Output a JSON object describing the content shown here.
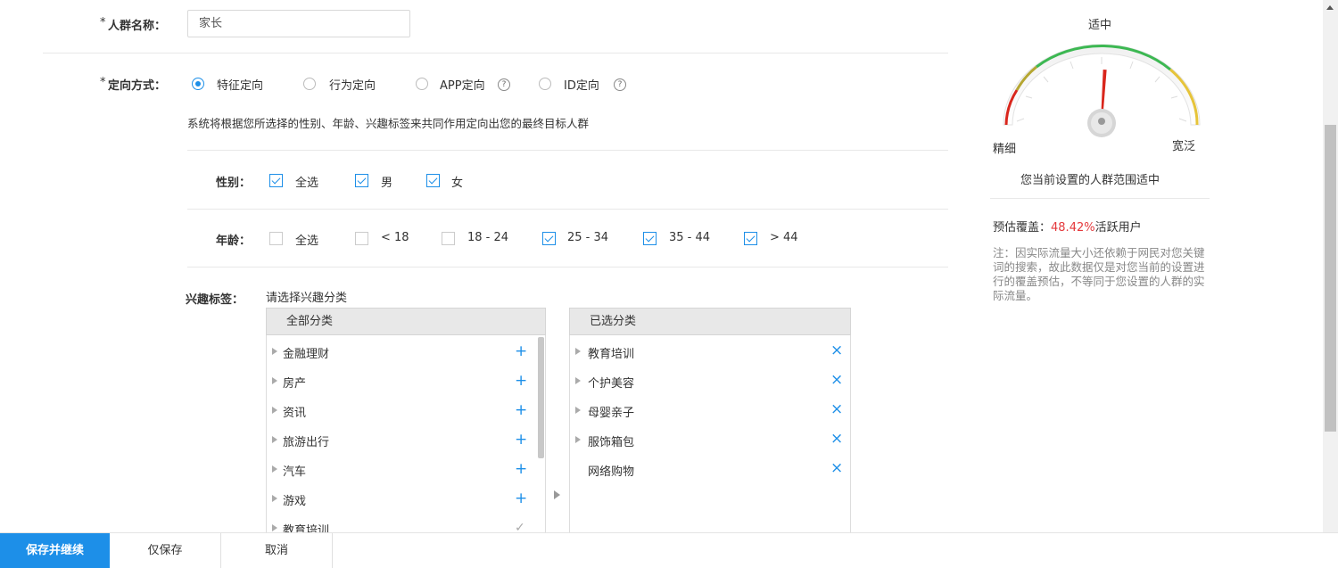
{
  "form": {
    "name_label": "人群名称：",
    "name_required": "*",
    "name_value": "家长",
    "target_label": "定向方式：",
    "target_required": "*",
    "target_options": [
      {
        "label": "特征定向",
        "selected": true
      },
      {
        "label": "行为定向",
        "selected": false
      },
      {
        "label": "APP定向",
        "selected": false
      },
      {
        "label": "ID定向",
        "selected": false
      }
    ],
    "help_glyph": "?",
    "description": "系统将根据您所选择的性别、年龄、兴趣标签来共同作用定向出您的最终目标人群",
    "gender_label": "性别：",
    "gender_options": [
      {
        "label": "全选",
        "checked": true
      },
      {
        "label": "男",
        "checked": true
      },
      {
        "label": "女",
        "checked": true
      }
    ],
    "age_label": "年龄：",
    "age_options": [
      {
        "label": "全选",
        "checked": false
      },
      {
        "label": "< 18",
        "checked": false
      },
      {
        "label": "18 - 24",
        "checked": false
      },
      {
        "label": "25 - 34",
        "checked": true
      },
      {
        "label": "35 - 44",
        "checked": true
      },
      {
        "label": "> 44",
        "checked": true
      }
    ],
    "interest_label": "兴趣标签：",
    "interest_hint": "请选择兴趣分类",
    "all_panel_title": "全部分类",
    "all_categories": [
      {
        "label": "金融理财",
        "action": "+",
        "added": false
      },
      {
        "label": "房产",
        "action": "+",
        "added": false
      },
      {
        "label": "资讯",
        "action": "+",
        "added": false
      },
      {
        "label": "旅游出行",
        "action": "+",
        "added": false
      },
      {
        "label": "汽车",
        "action": "+",
        "added": false
      },
      {
        "label": "游戏",
        "action": "+",
        "added": false
      },
      {
        "label": "教育培训",
        "action": "✓",
        "added": true
      }
    ],
    "selected_panel_title": "已选分类",
    "selected_categories": [
      {
        "label": "教育培训",
        "expandable": true
      },
      {
        "label": "个护美容",
        "expandable": true
      },
      {
        "label": "母婴亲子",
        "expandable": true
      },
      {
        "label": "服饰箱包",
        "expandable": true
      },
      {
        "label": "网络购物",
        "expandable": false
      }
    ],
    "remove_glyph": "×"
  },
  "gauge": {
    "title": "适中",
    "left_label": "精细",
    "right_label": "宽泛",
    "status": "您当前设置的人群范围适中",
    "needle_level": 0.52,
    "coverage_prefix": "预估覆盖：",
    "coverage_value": "48.42%",
    "coverage_suffix": "活跃用户",
    "note": "注：因实际流量大小还依赖于网民对您关键词的搜索，故此数据仅是对您当前的设置进行的覆盖预估，不等同于您设置的人群的实际流量。"
  },
  "footer": {
    "save_continue": "保存并继续",
    "save_only": "仅保存",
    "cancel": "取消"
  },
  "colors": {
    "accent": "#1d8fe8",
    "required": "#e4393c",
    "coverage": "#e4393c",
    "gauge_red": "#d9261c",
    "gauge_green": "#3cb852",
    "gauge_yellow": "#e6c43a"
  }
}
